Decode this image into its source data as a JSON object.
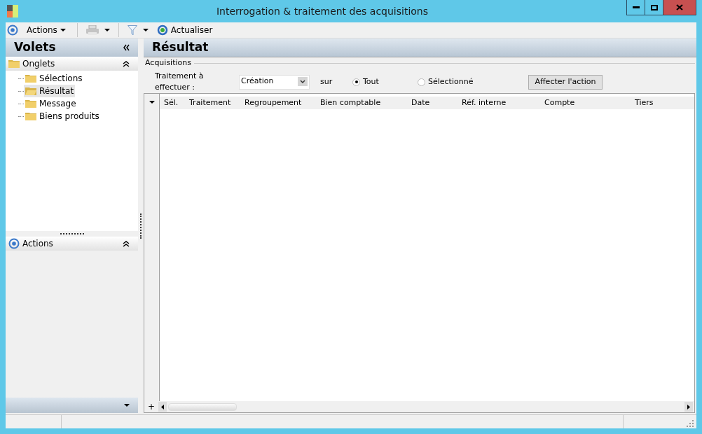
{
  "window": {
    "title": "Interrogation & traitement des acquisitions"
  },
  "toolbar": [
    {
      "kind": "menu",
      "label": "Actions"
    },
    {
      "kind": "print"
    },
    {
      "kind": "filter"
    },
    {
      "kind": "refresh",
      "label": "Actualiser"
    }
  ],
  "sidebar": {
    "title": "Volets",
    "sections": [
      {
        "title": "Onglets",
        "kind": "folder",
        "expanded": true,
        "items": [
          {
            "label": "Sélections",
            "selected": false
          },
          {
            "label": "Résultat",
            "selected": true
          },
          {
            "label": "Message",
            "selected": false
          },
          {
            "label": "Biens produits",
            "selected": false
          }
        ]
      },
      {
        "title": "Actions",
        "kind": "circle",
        "expanded": true
      }
    ]
  },
  "main": {
    "title": "Résultat",
    "group": "Acquisitions",
    "field_label": "Traitement à effectuer :",
    "dropdown": {
      "value": "Création"
    },
    "sur_label": "sur",
    "radios": [
      {
        "label": "Tout",
        "selected": true
      },
      {
        "label": "Sélectionné",
        "selected": false
      }
    ],
    "button": "Affecter l'action",
    "table": {
      "columns": [
        "Sél.",
        "Traitement",
        "Regroupement",
        "Bien comptable",
        "Date",
        "Réf. interne",
        "Compte",
        "Tiers"
      ],
      "add_label": "+"
    }
  }
}
